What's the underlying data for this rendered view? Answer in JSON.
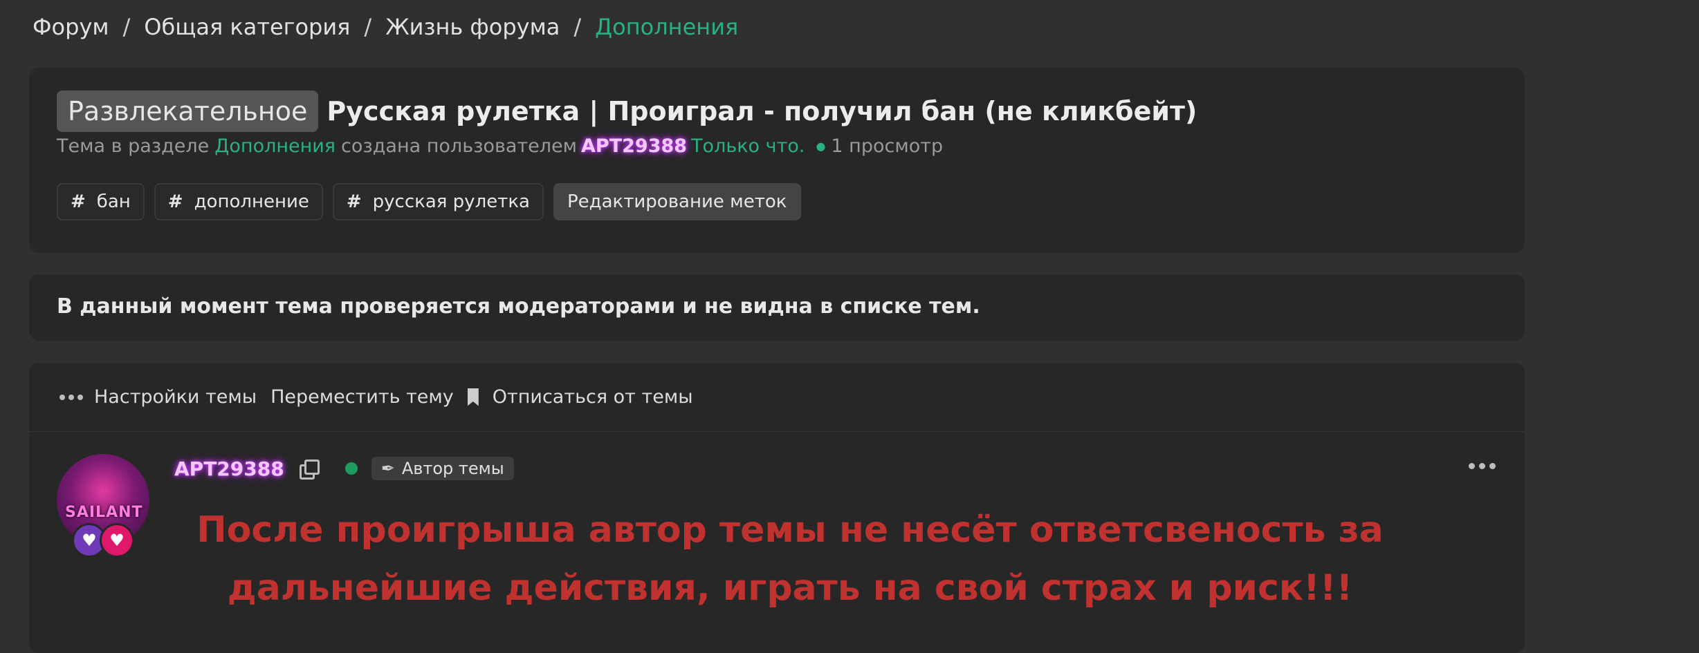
{
  "breadcrumb": {
    "items": [
      "Форум",
      "Общая категория",
      "Жизнь форума"
    ],
    "separator": "/",
    "active": "Дополнения"
  },
  "thread": {
    "prefix": "Развлекательное",
    "title": "Русская рулетка | Проиграл - получил бан (не кликбейт)",
    "meta_prefix": "Тема в разделе",
    "section": "Дополнения",
    "meta_middle": "создана пользователем",
    "author": "APT29388",
    "time": "Только что.",
    "views": "1 просмотр",
    "tags": [
      "бан",
      "дополнение",
      "русская рулетка"
    ],
    "edit_tags_label": "Редактирование меток"
  },
  "notice": {
    "text": "В данный момент тема проверяется модераторами и не видна в списке тем."
  },
  "toolbar": {
    "settings_label": "Настройки темы",
    "move_label": "Переместить тему",
    "unsubscribe_label": "Отписаться от темы"
  },
  "post": {
    "author": "APT29388",
    "avatar_text": "SAILANT",
    "author_badge": "Автор темы",
    "body": "После проигрыша автор темы не несёт ответсвеность за дальнейшие действия, играть на свой страх и риск!!!"
  },
  "colors": {
    "accent": "#2bb07f",
    "post_text": "#c0322f",
    "online": "#1e9b5e",
    "background": "#303030",
    "card": "#272727"
  },
  "icons": [
    "more-dots-icon",
    "bookmark-icon",
    "copy-icon",
    "online-status-icon",
    "feather-icon",
    "heart-icon"
  ]
}
